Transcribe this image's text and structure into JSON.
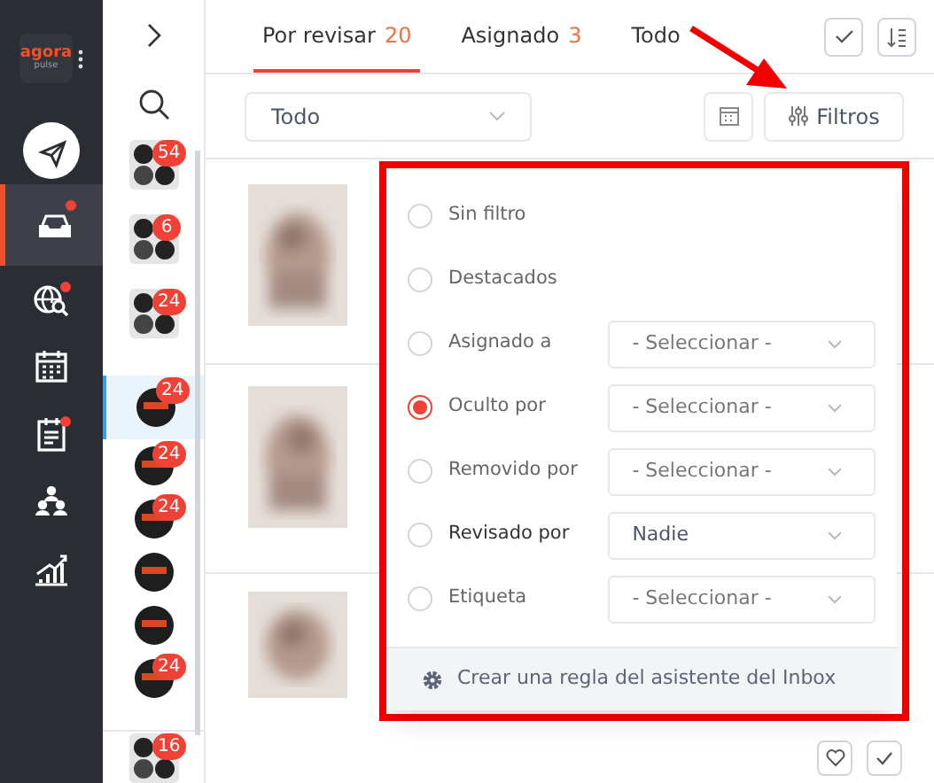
{
  "logo": {
    "word": "agora",
    "sub": "pulse"
  },
  "nav": [
    {
      "selected": false,
      "dot": false
    },
    {
      "selected": true,
      "dot": true
    },
    {
      "selected": false,
      "dot": true
    },
    {
      "selected": false,
      "dot": false
    },
    {
      "selected": false,
      "dot": true
    },
    {
      "selected": false,
      "dot": false
    },
    {
      "selected": false,
      "dot": false
    }
  ],
  "accounts": [
    {
      "kind": "group",
      "count": "54",
      "selected": false
    },
    {
      "kind": "group",
      "count": "6",
      "selected": false
    },
    {
      "kind": "group",
      "count": "24",
      "selected": false
    },
    {
      "kind": "single",
      "count": "24",
      "selected": true
    },
    {
      "kind": "single",
      "count": "24",
      "selected": false
    },
    {
      "kind": "single",
      "count": "24",
      "selected": false
    },
    {
      "kind": "single",
      "selected": false
    },
    {
      "kind": "single",
      "selected": false
    },
    {
      "kind": "single",
      "count": "24",
      "selected": false
    },
    {
      "kind": "group",
      "count": "16",
      "selected": false
    }
  ],
  "tabs": [
    {
      "label": "Por revisar",
      "count": "20",
      "selected": true
    },
    {
      "label": "Asignado",
      "count": "3",
      "selected": false
    },
    {
      "label": "Todo",
      "selected": false
    }
  ],
  "scope_dropdown": {
    "value": "Todo"
  },
  "filters_button": {
    "label": "Filtros"
  },
  "filters": [
    {
      "label": "Sin filtro",
      "selected": false
    },
    {
      "label": "Destacados",
      "selected": false
    },
    {
      "label": "Asignado a",
      "selected": false,
      "select": {
        "value": "- Seleccionar -",
        "placeholder": true
      }
    },
    {
      "label": "Oculto por",
      "selected": true,
      "select": {
        "value": "- Seleccionar -",
        "placeholder": true
      }
    },
    {
      "label": "Removido por",
      "selected": false,
      "select": {
        "value": "- Seleccionar -",
        "placeholder": true
      }
    },
    {
      "label": "Revisado por",
      "selected": false,
      "select": {
        "value": "Nadie",
        "placeholder": false
      }
    },
    {
      "label": "Etiqueta",
      "selected": false,
      "select": {
        "value": "- Seleccionar -",
        "placeholder": true
      }
    }
  ],
  "footer_link": "Crear una regla del asistente del Inbox"
}
